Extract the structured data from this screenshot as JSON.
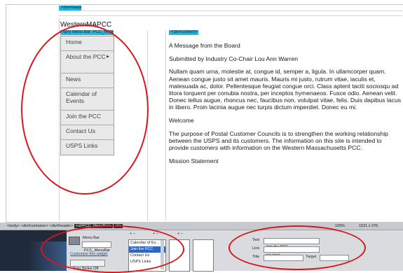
{
  "page": {
    "outer_tag": "<div#header>",
    "site_title": "WesternMAPCC",
    "menu_tag": "Spry Menu Bar: PCC_MenuBar",
    "content_tag": "<div#content>"
  },
  "menu_items": [
    {
      "label": "Home",
      "has_submenu": false
    },
    {
      "label": "About the PCC",
      "has_submenu": true
    },
    {
      "label": "News",
      "has_submenu": false
    },
    {
      "label": "Calendar of Events",
      "has_submenu": false
    },
    {
      "label": "Join the PCC",
      "has_submenu": false
    },
    {
      "label": "Contact Us",
      "has_submenu": false
    },
    {
      "label": "USPS Links",
      "has_submenu": false
    }
  ],
  "content": {
    "heading": "A Message from the Board",
    "byline": "Submitted by Industry Co-Chair Lou Ann Warren",
    "lorem": "Nullam quam urna, molestie at, congue id, semper a, ligula. In ullamcorper quam. Aenean congue justo sit amet mauris. Mauris mi justo, rutrum vitae, iaculis et, malesuada ac, dolor. Pellentesque feugiat congue orci. Class aptent taciti sociosqu ad litora torquent per conubia nostra, per inceptos hymenaeos. Fusce odio. Aenean velit. Donec tellus augue, rhoncus nec, faucibus non, volutpat vitae, felis. Duis dapibus lacus in libero. Proin lacinia augue nec turpis dictum imperdiet. Donec eu mi.",
    "welcome": "Welcome",
    "purpose": "The purpose of Postal Customer Councils is to strengthen the working relationship between the USPS and its customers. The information on this site is intended to provide customers with information on the Western Massachusetts PCC.",
    "mission": "Mission Statement"
  },
  "status_bar": {
    "tags": [
      "<body>",
      "<div#container>",
      "<div#header>",
      "<ul#PCC_MenuBar>"
    ],
    "active_tag": "<li>",
    "zoom": "100%",
    "size": "1021 x 376"
  },
  "properties": {
    "widget_label": "Menu Bar",
    "widget_name": "PCC_MenuBar",
    "customize_link": "Customize this widget",
    "turn_styles_btn": "Turn Styles Off",
    "list_controls": [
      "+ −",
      "+ −",
      "+ −"
    ],
    "item_list": [
      "Calendar of Ev...",
      "Join the PCC",
      "Contact Us",
      "USPS Links"
    ],
    "selected_item": "Join the PCC",
    "text_label": "Text",
    "text_value": "Join the PCC",
    "link_label": "Link",
    "link_value": "join.html",
    "title_label": "Title",
    "target_label": "Target"
  },
  "colors": {
    "annotation_red": "#d9161c",
    "label_tag_blue": "#25b3d8",
    "menu_bg": "#e9e9e9",
    "selection_blue": "#2f65c4"
  }
}
